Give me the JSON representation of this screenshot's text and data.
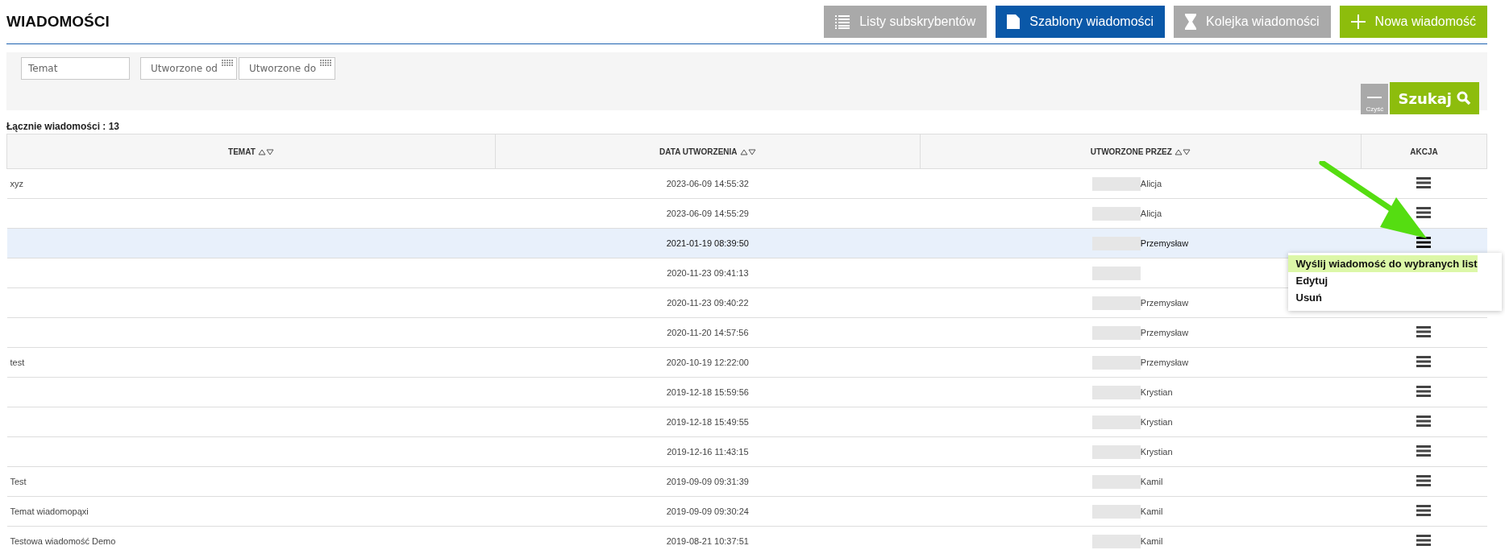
{
  "page_title": "WIADOMOŚCI",
  "toolbar": [
    {
      "label": "Listy subskrybentów",
      "kind": "list"
    },
    {
      "label": "Szablony wiadomości",
      "kind": "document"
    },
    {
      "label": "Kolejka wiadomości",
      "kind": "hourglass"
    },
    {
      "label": "Nowa wiadomość",
      "kind": "plus"
    }
  ],
  "filters": {
    "subject": {
      "placeholder": "Temat"
    },
    "from": {
      "placeholder": "Utworzone od"
    },
    "to": {
      "placeholder": "Utworzone do"
    },
    "clear_label": "Czyść",
    "search_label": "Szukaj"
  },
  "total": "Łącznie wiadomości : 13",
  "table": {
    "columns": [
      {
        "label": "TEMAT",
        "sortable": true
      },
      {
        "label": "DATA UTWORZENIA",
        "sortable": true
      },
      {
        "label": "UTWORZONE PRZEZ",
        "sortable": true
      },
      {
        "label": "AKCJA",
        "sortable": false
      }
    ],
    "rows": [
      {
        "subject": "xyz",
        "date": "2023-06-09 14:55:32",
        "author": "Alicja",
        "selected": false
      },
      {
        "subject": "",
        "date": "2023-06-09 14:55:29",
        "author": "Alicja",
        "selected": false
      },
      {
        "subject": "",
        "date": "2021-01-19 08:39:50",
        "author": "Przemysław",
        "selected": true,
        "menu": [
          {
            "label": "Wyślij wiadomość do wybranych list",
            "selected": true
          },
          {
            "label": "Edytuj",
            "selected": false
          },
          {
            "label": "Usuń",
            "selected": false
          }
        ]
      },
      {
        "subject": "",
        "date": "2020-11-23 09:41:13",
        "author": "",
        "selected": false
      },
      {
        "subject": "",
        "date": "2020-11-23 09:40:22",
        "author": "Przemysław",
        "selected": false
      },
      {
        "subject": "",
        "date": "2020-11-20 14:57:56",
        "author": "Przemysław",
        "selected": false
      },
      {
        "subject": "test",
        "date": "2020-10-19 12:22:00",
        "author": "Przemysław",
        "selected": false
      },
      {
        "subject": "",
        "date": "2019-12-18 15:59:56",
        "author": "Krystian",
        "selected": false
      },
      {
        "subject": "",
        "date": "2019-12-18 15:49:55",
        "author": "Krystian",
        "selected": false
      },
      {
        "subject": "",
        "date": "2019-12-16 11:43:15",
        "author": "Krystian",
        "selected": false
      },
      {
        "subject": "Test",
        "date": "2019-09-09 09:31:39",
        "author": "Kamil",
        "selected": false
      },
      {
        "subject": "Temat wiadomopąxi",
        "date": "2019-09-09 09:30:24",
        "author": "Kamil",
        "selected": false
      },
      {
        "subject": "Testowa wiadomość Demo",
        "date": "2019-08-21 10:37:51",
        "author": "Kamil",
        "selected": false
      }
    ]
  }
}
